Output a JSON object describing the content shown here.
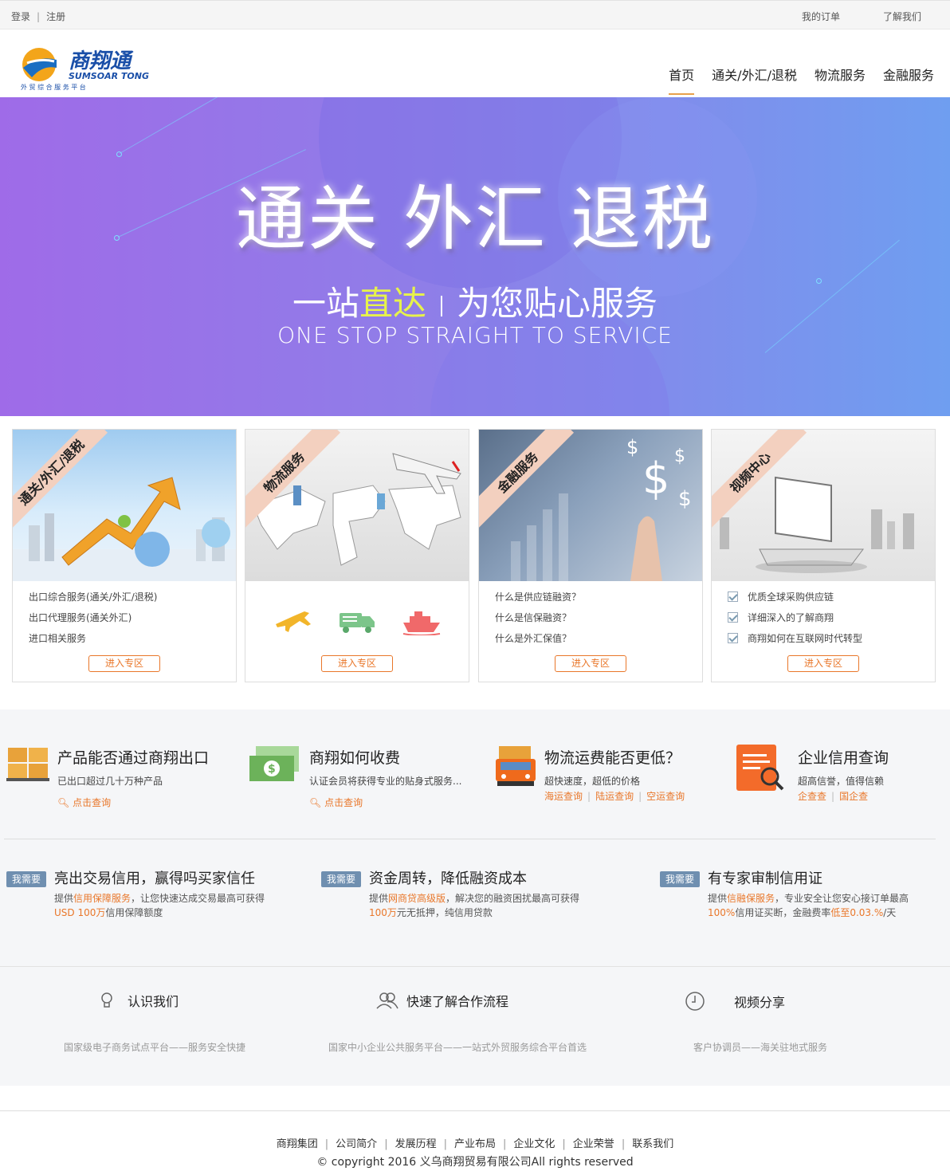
{
  "topbar": {
    "login": "登录",
    "register": "注册",
    "my_orders": "我的订单",
    "about_us": "了解我们"
  },
  "logo": {
    "name": "商翔通",
    "en": "SUMSOAR TONG",
    "slogan": "外 贸 综 合 服 务 平 台"
  },
  "nav": [
    {
      "label": "首页",
      "active": true
    },
    {
      "label": "通关/外汇/退税",
      "active": false
    },
    {
      "label": "物流服务",
      "active": false
    },
    {
      "label": "金融服务",
      "active": false
    }
  ],
  "banner": {
    "title": "通关 外汇 退税",
    "tag_a": "一站",
    "tag_highlight": "直达",
    "tag_b": "为您贴心服务",
    "english": "ONE STOP STRAIGHT TO SERVICE"
  },
  "cards": [
    {
      "ribbon": "通关/外汇/退税",
      "items": [
        "出口综合服务(通关/外汇/退税)",
        "出口代理服务(通关外汇)",
        "进口相关服务"
      ],
      "button": "进入专区"
    },
    {
      "ribbon": "物流服务",
      "icons": [
        "airplane-icon",
        "truck-icon",
        "ship-icon"
      ],
      "button": "进入专区"
    },
    {
      "ribbon": "金融服务",
      "items": [
        "什么是供应链融资？",
        "什么是信保融资？",
        "什么是外汇保值？"
      ],
      "button": "进入专区"
    },
    {
      "ribbon": "视频中心",
      "items": [
        "优质全球采购供应链",
        "详细深入的了解商翔",
        "商翔如何在互联网时代转型"
      ],
      "button": "进入专区"
    }
  ],
  "services": [
    {
      "title": "产品能否通过商翔出口",
      "desc": "已出口超过几十万种产品",
      "link": "点击查询"
    },
    {
      "title": "商翔如何收费",
      "desc": "认证会员将获得专业的贴身式服务...",
      "link": "点击查询"
    },
    {
      "title": "物流运费能否更低？",
      "desc": "超快速度，超低的价格",
      "links": [
        "海运查询",
        "陆运查询",
        "空运查询"
      ]
    },
    {
      "title": "企业信用查询",
      "desc": "超高信誉，值得信赖",
      "links": [
        "企查查",
        "国企查"
      ]
    }
  ],
  "needs": [
    {
      "badge": "我需要",
      "title": "亮出交易信用，赢得吗买家信任",
      "l1a": "提供",
      "l1o": "信用保障服务",
      "l1b": "，让您快速达成交易最高可获得",
      "l2o": "USD 100万",
      "l2b": "信用保障额度"
    },
    {
      "badge": "我需要",
      "title": "资金周转，降低融资成本",
      "l1a": "提供",
      "l1o": "网商贷高级版",
      "l1b": "，解决您的融资困扰最高可获得",
      "l2o": "100万",
      "l2b": "元无抵押，纯信用贷款"
    },
    {
      "badge": "我需要",
      "title": "有专家审制信用证",
      "l1a": "提供",
      "l1o": "信融保服务",
      "l1b": "，专业安全让您安心接订单最高",
      "l2o": "100%",
      "l2b": "信用证买断，金融费率",
      "l2o2": "低至0.03.%",
      "l2c": "/天"
    }
  ],
  "about": [
    {
      "label": "认识我们",
      "icon": "lightbulb-icon",
      "desc": "国家级电子商务试点平台——服务安全快捷"
    },
    {
      "label": "快速了解合作流程",
      "icon": "users-icon",
      "desc": "国家中小企业公共服务平台——一站式外贸服务综合平台首选"
    },
    {
      "label": "视频分享",
      "icon": "clock-icon",
      "desc": "客户协调员——海关驻地式服务"
    }
  ],
  "footer": {
    "links": [
      "商翔集团",
      "公司简介",
      "发展历程",
      "产业布局",
      "企业文化",
      "企业荣誉",
      "联系我们"
    ],
    "copyright": "© copyright 2016 义乌商翔贸易有限公司All rights reserved"
  }
}
